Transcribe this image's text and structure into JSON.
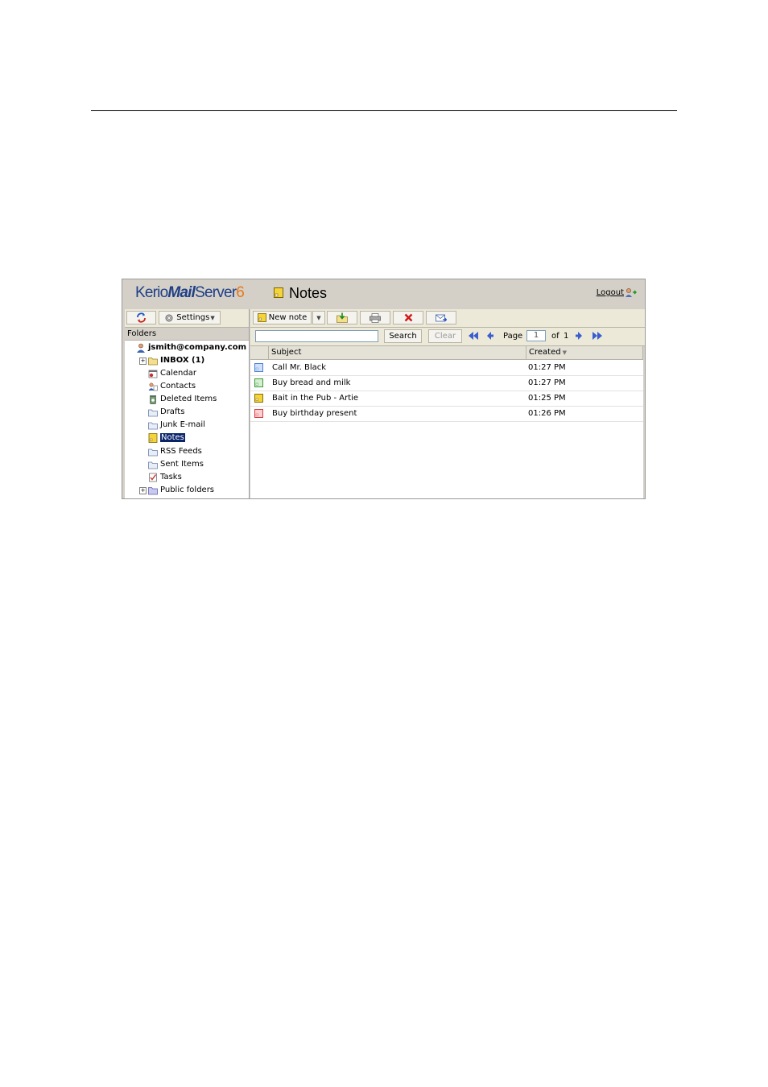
{
  "header": {
    "logo_prefix": "Kerio",
    "logo_mail": "Mail",
    "logo_server": "Server",
    "logo_version": "6",
    "title": "Notes",
    "logout_label": "Logout"
  },
  "left_toolbar": {
    "settings_label": "Settings"
  },
  "folders": {
    "header": "Folders",
    "account": "jsmith@company.com",
    "items": [
      {
        "label": "INBOX (1)",
        "icon": "folder-icon"
      },
      {
        "label": "Calendar",
        "icon": "calendar-icon"
      },
      {
        "label": "Contacts",
        "icon": "contacts-icon"
      },
      {
        "label": "Deleted Items",
        "icon": "trash-icon"
      },
      {
        "label": "Drafts",
        "icon": "drafts-folder-icon"
      },
      {
        "label": "Junk E-mail",
        "icon": "junk-folder-icon"
      },
      {
        "label": "Notes",
        "icon": "note-icon"
      },
      {
        "label": "RSS Feeds",
        "icon": "rss-folder-icon"
      },
      {
        "label": "Sent Items",
        "icon": "sent-folder-icon"
      },
      {
        "label": "Tasks",
        "icon": "tasks-icon"
      },
      {
        "label": "Public folders",
        "icon": "public-folder-icon"
      }
    ]
  },
  "toolbar": {
    "new_note_label": "New note",
    "search_value": "",
    "search_label": "Search",
    "clear_label": "Clear",
    "page_label": "Page",
    "page_value": "1",
    "of_label": "of",
    "total_pages": "1"
  },
  "grid": {
    "columns": [
      "Subject",
      "Created"
    ],
    "rows": [
      {
        "subject": "Call Mr. Black",
        "created": "01:27 PM",
        "color": "#4a7fd4"
      },
      {
        "subject": "Buy bread and milk",
        "created": "01:27 PM",
        "color": "#3a9a3a"
      },
      {
        "subject": "Bait in the Pub - Artie",
        "created": "01:25 PM",
        "color": "#d8b400"
      },
      {
        "subject": "Buy birthday present",
        "created": "01:26 PM",
        "color": "#d84040"
      }
    ]
  },
  "colors": {
    "brand_blue": "#1f3f86",
    "brand_orange": "#e8781a",
    "selection": "#0a246a"
  }
}
